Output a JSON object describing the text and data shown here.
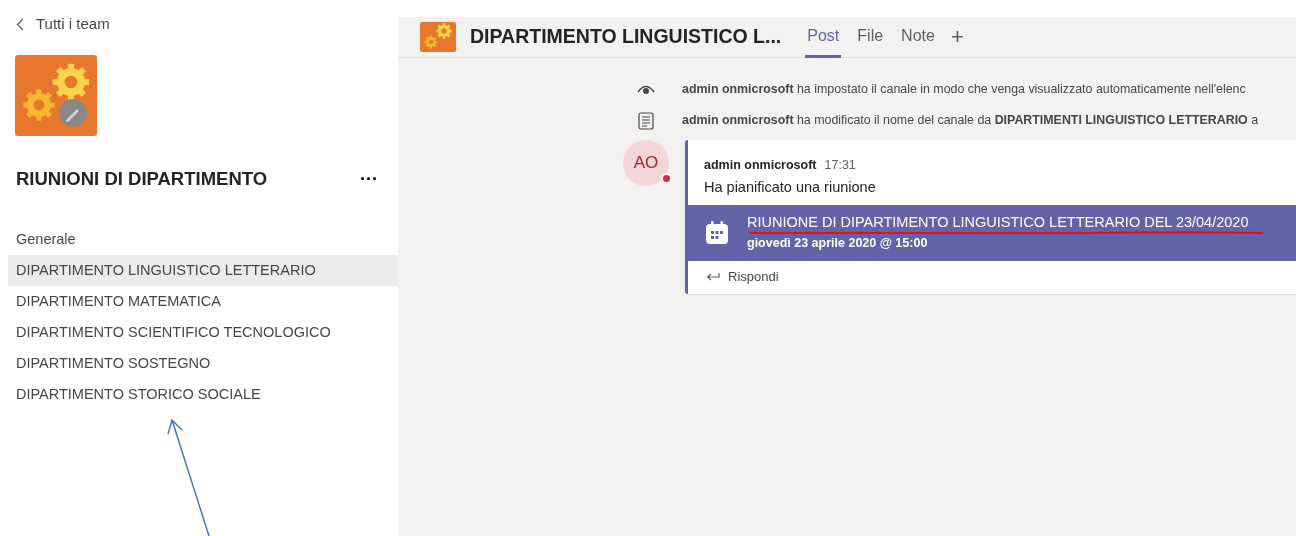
{
  "back_link": {
    "label": "Tutti i team"
  },
  "team": {
    "name": "RIUNIONI DI DIPARTIMENTO",
    "more": "···"
  },
  "channels": [
    {
      "label": "Generale",
      "selected": false
    },
    {
      "label": "DIPARTIMENTO LINGUISTICO LETTERARIO",
      "selected": true
    },
    {
      "label": "DIPARTIMENTO MATEMATICA",
      "selected": false
    },
    {
      "label": "DIPARTIMENTO SCIENTIFICO TECNOLOGICO",
      "selected": false
    },
    {
      "label": "DIPARTIMENTO SOSTEGNO",
      "selected": false
    },
    {
      "label": "DIPARTIMENTO STORICO SOCIALE",
      "selected": false
    }
  ],
  "header": {
    "channel_title": "DIPARTIMENTO LINGUISTICO L...",
    "tabs": [
      {
        "label": "Post",
        "selected": true
      },
      {
        "label": "File",
        "selected": false
      },
      {
        "label": "Note",
        "selected": false
      }
    ],
    "add_tab": "+"
  },
  "system_messages": [
    {
      "kind": "visibility",
      "text": "**admin onmicrosoft** ha impostato il canale in modo che venga visualizzato automaticamente nell'elenc"
    },
    {
      "kind": "rename",
      "text": "**admin onmicrosoft** ha modificato il nome del canale da **DIPARTIMENTI LINGUISTICO LETTERARIO** a"
    }
  ],
  "post": {
    "avatar": "AO",
    "author": "admin onmicrosoft",
    "time": "17:31",
    "text": "Ha pianificato una riunione",
    "meeting": {
      "title": "RIUNIONE DI DIPARTIMENTO LINGUISTICO LETTERARIO DEL 23/04/2020",
      "when": "giovedì 23 aprile 2020 @ 15:00"
    },
    "reply": "Rispondi"
  }
}
